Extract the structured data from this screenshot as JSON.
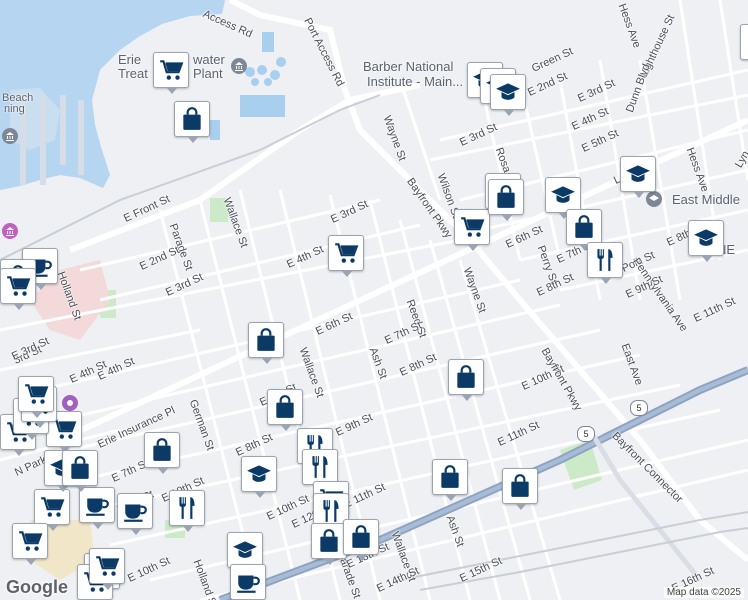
{
  "map": {
    "provider_logo": "Google",
    "attribution": "Map data ©2025",
    "colors": {
      "water": "#b5d5f0",
      "land": "#eef0f3",
      "road": "#ffffff",
      "highway": "#8ea4c4",
      "park": "#cdeac8",
      "marker_icon": "#0b3a66"
    }
  },
  "street_labels": [
    "Access Rd",
    "Port Access Rd",
    "Wayne St",
    "E 3rd St",
    "Rosa St",
    "Wilson St",
    "Bayfront Pkwy",
    "E 2nd St",
    "Green St",
    "E 3rd St",
    "E 4th St",
    "E 5th St",
    "Lighthouse St",
    "Dunn Blvd",
    "Hess Ave",
    "Hess Ave",
    "Lake Rd",
    "E 6th St",
    "Perry St",
    "E 7th St",
    "Polk St",
    "Pennsylvania Ave",
    "E 8th St",
    "E 9th St",
    "E 8th",
    "E 11th St",
    "E 10th St",
    "E 11th St",
    "Wayne St",
    "Reed St",
    "E 7th St",
    "E 8th St",
    "Ash St",
    "E 6th St",
    "E 4th St",
    "E 3rd St",
    "E Front St",
    "Parade St",
    "Wallace St",
    "E 2nd St",
    "E 3rd St",
    "Holland St",
    "E 4th St",
    "E 5th St",
    "Wallace St",
    "German St",
    "Erie Insurance Pl",
    "E 8th St",
    "E 9th St",
    "E 10th St",
    "E 7th St",
    "E 8th St",
    "N Park",
    "E 10th St",
    "Holland St",
    "Parade St",
    "Wallace St",
    "E 14th St",
    "E 15th St",
    "Ash St",
    "E 11th St",
    "Bayfront Connector",
    "East Ave",
    "Bayfront Pkwy",
    "E 12th St",
    "E 13th St",
    "Lyn",
    "E 4th St",
    "3rd St",
    "E 3rd St",
    "E 10th St",
    "E 16th St"
  ],
  "poi_labels": {
    "water_plant": "Erie Westwater Treatment Plant",
    "water_plant_line1": "Erie",
    "water_plant_line1b": "water",
    "water_plant_line2": "Treat",
    "water_plant_line2b": "Plant",
    "barber": "Barber National Institute - Main...",
    "barber_line1": "Barber National",
    "barber_line2": "Institute - Main...",
    "east_middle": "East Middle",
    "beach_line1": "Beach",
    "beach_line2": "ning",
    "east_trunc": "NE",
    "east_trunc2": "CE"
  },
  "route_shields": [
    "5",
    "5"
  ],
  "markers": {
    "types": [
      "shopping-cart",
      "shopping-bag",
      "graduation-cap",
      "restaurant",
      "cafe"
    ]
  }
}
